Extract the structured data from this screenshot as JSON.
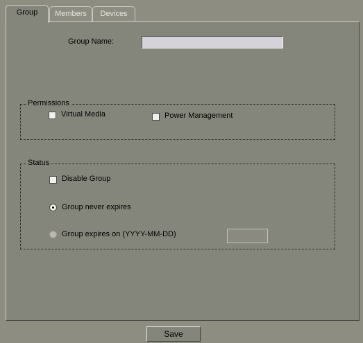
{
  "tabs": [
    {
      "label": "Group",
      "active": true
    },
    {
      "label": "Members",
      "active": false
    },
    {
      "label": "Devices",
      "active": false
    }
  ],
  "group_name": {
    "label": "Group Name:",
    "value": ""
  },
  "permissions": {
    "legend": "Permissions",
    "virtual_media": {
      "label": "Virtual Media",
      "checked": false
    },
    "power_management": {
      "label": "Power Management",
      "checked": false
    }
  },
  "status": {
    "legend": "Status",
    "disable_group": {
      "label": "Disable Group",
      "checked": false
    },
    "never_expires": {
      "label": "Group never expires",
      "selected": true
    },
    "expires_on": {
      "label": "Group expires on (YYYY-MM-DD)",
      "selected": false,
      "enabled": false,
      "date_value": ""
    }
  },
  "save_button": {
    "label": "Save"
  },
  "colors": {
    "background": "#8d8d82",
    "panel": "#85867b",
    "textbox": "#d6d2da"
  }
}
